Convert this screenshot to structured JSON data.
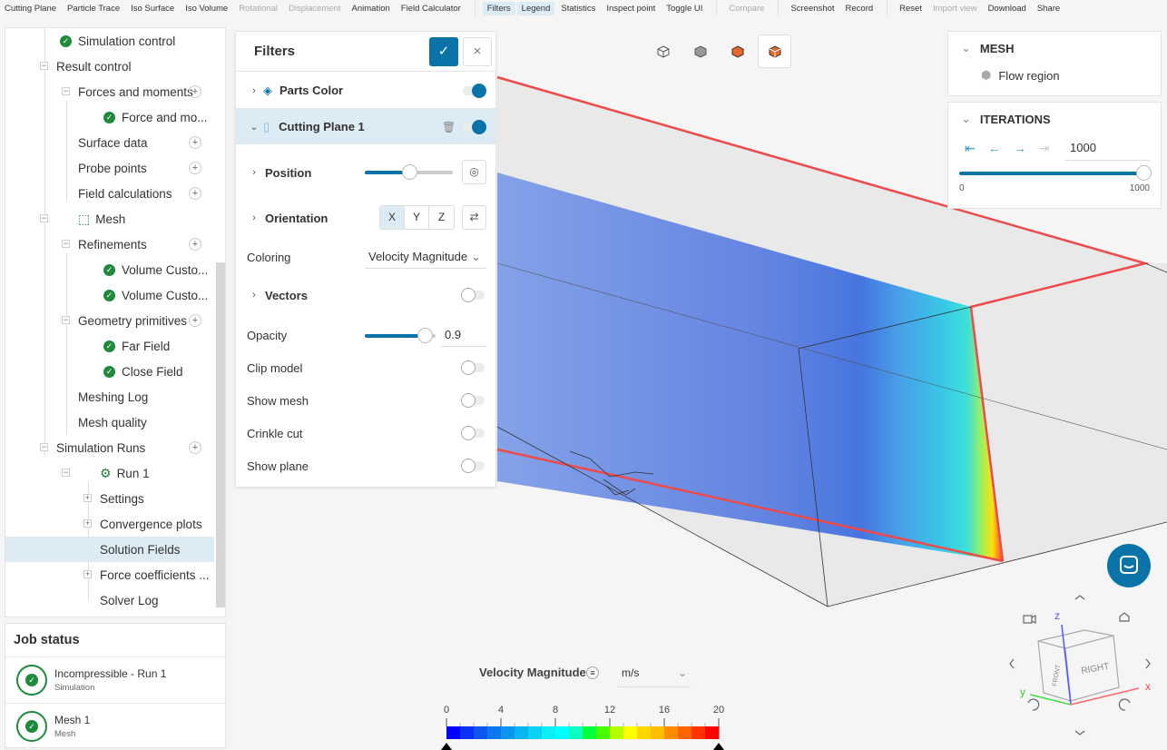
{
  "toolbar": {
    "items": [
      {
        "label": "Cutting Plane",
        "state": "normal"
      },
      {
        "label": "Particle Trace",
        "state": "normal"
      },
      {
        "label": "Iso Surface",
        "state": "normal"
      },
      {
        "label": "Iso Volume",
        "state": "normal"
      },
      {
        "label": "Rotational",
        "state": "disabled"
      },
      {
        "label": "Displacement",
        "state": "disabled"
      },
      {
        "label": "Animation",
        "state": "normal"
      },
      {
        "label": "Field Calculator",
        "state": "normal"
      },
      {
        "label": "Filters",
        "state": "active"
      },
      {
        "label": "Legend",
        "state": "active"
      },
      {
        "label": "Statistics",
        "state": "normal"
      },
      {
        "label": "Inspect point",
        "state": "normal"
      },
      {
        "label": "Toggle UI",
        "state": "normal"
      },
      {
        "label": "Compare",
        "state": "disabled"
      },
      {
        "label": "Screenshot",
        "state": "normal"
      },
      {
        "label": "Record",
        "state": "normal"
      },
      {
        "label": "Reset",
        "state": "normal"
      },
      {
        "label": "Import view",
        "state": "disabled"
      },
      {
        "label": "Download",
        "state": "normal"
      },
      {
        "label": "Share",
        "state": "normal"
      }
    ]
  },
  "tree": {
    "items": [
      {
        "label": "Simulation control",
        "check": true
      },
      {
        "label": "Result control"
      },
      {
        "label": "Forces and moments"
      },
      {
        "label": "Force and mo...",
        "check": true
      },
      {
        "label": "Surface data"
      },
      {
        "label": "Probe points"
      },
      {
        "label": "Field calculations"
      },
      {
        "label": "Mesh"
      },
      {
        "label": "Refinements"
      },
      {
        "label": "Volume Custo...",
        "check": true
      },
      {
        "label": "Volume Custo...",
        "check": true
      },
      {
        "label": "Geometry primitives"
      },
      {
        "label": "Far Field",
        "check": true
      },
      {
        "label": "Close Field",
        "check": true
      },
      {
        "label": "Meshing Log"
      },
      {
        "label": "Mesh quality"
      },
      {
        "label": "Simulation Runs"
      },
      {
        "label": "Run 1"
      },
      {
        "label": "Settings"
      },
      {
        "label": "Convergence plots"
      },
      {
        "label": "Solution Fields",
        "selected": true
      },
      {
        "label": "Force coefficients ..."
      },
      {
        "label": "Solver Log"
      }
    ]
  },
  "job_status": {
    "title": "Job status",
    "jobs": [
      {
        "name": "Incompressible - Run 1",
        "type": "Simulation"
      },
      {
        "name": "Mesh 1",
        "type": "Mesh"
      }
    ]
  },
  "filters": {
    "title": "Filters",
    "parts_color": "Parts Color",
    "cutting_plane": "Cutting Plane 1",
    "position": {
      "label": "Position",
      "value_fraction": 0.5
    },
    "orientation": {
      "label": "Orientation",
      "options": [
        "X",
        "Y",
        "Z"
      ],
      "selected": "X"
    },
    "coloring": {
      "label": "Coloring",
      "value": "Velocity Magnitude"
    },
    "vectors": "Vectors",
    "opacity": {
      "label": "Opacity",
      "value": "0.9"
    },
    "clip_model": "Clip model",
    "show_mesh": "Show mesh",
    "crinkle_cut": "Crinkle cut",
    "show_plane": "Show plane"
  },
  "mesh_panel": {
    "title": "MESH",
    "item": "Flow region"
  },
  "iterations": {
    "title": "ITERATIONS",
    "value": "1000",
    "min": "0",
    "max": "1000",
    "fraction": 1.0
  },
  "legend": {
    "title": "Velocity Magnitude",
    "unit": "m/s",
    "ticks": [
      "0",
      "4",
      "8",
      "12",
      "16",
      "20"
    ],
    "colors": [
      "#0000ff",
      "#0a32f5",
      "#0f55f0",
      "#0a78f0",
      "#0a96f0",
      "#0ab4f0",
      "#0ad2f5",
      "#0af0f5",
      "#00ffff",
      "#0affc3",
      "#00ff3c",
      "#46ff00",
      "#b4ff00",
      "#ffff00",
      "#ffd700",
      "#ffbe00",
      "#ff8c00",
      "#ff6400",
      "#ff3200",
      "#ff0000"
    ]
  },
  "viewcube": {
    "front": "FRONT",
    "right": "RIGHT",
    "x": "x",
    "y": "y",
    "z": "z"
  }
}
